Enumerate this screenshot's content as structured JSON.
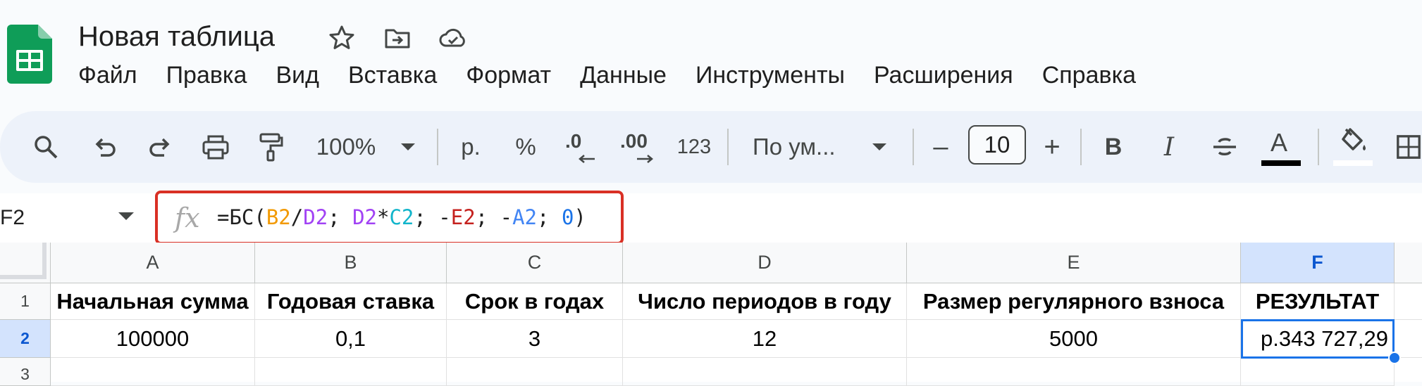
{
  "doc": {
    "title": "Новая таблица"
  },
  "menu": [
    "Файл",
    "Правка",
    "Вид",
    "Вставка",
    "Формат",
    "Данные",
    "Инструменты",
    "Расширения",
    "Справка"
  ],
  "toolbar": {
    "zoom": "100%",
    "currency": "р.",
    "percent": "%",
    "dec_decrease": ".0",
    "dec_increase": ".00",
    "number_format": "123",
    "font": "По ум...",
    "font_size": "10",
    "minus": "–",
    "plus": "+",
    "bold": "B",
    "italic": "I",
    "text_color_glyph": "A"
  },
  "formula_bar": {
    "name_box": "F2",
    "fx": "fx",
    "tokens": [
      {
        "t": "=БС(",
        "c": ""
      },
      {
        "t": "B2",
        "c": "c-b2"
      },
      {
        "t": "/",
        "c": ""
      },
      {
        "t": "D2",
        "c": "c-d2"
      },
      {
        "t": "; ",
        "c": ""
      },
      {
        "t": "D2",
        "c": "c-d2"
      },
      {
        "t": "*",
        "c": ""
      },
      {
        "t": "C2",
        "c": "c-c2"
      },
      {
        "t": "; -",
        "c": ""
      },
      {
        "t": "E2",
        "c": "c-e2"
      },
      {
        "t": "; -",
        "c": ""
      },
      {
        "t": "A2",
        "c": "c-a2"
      },
      {
        "t": "; ",
        "c": ""
      },
      {
        "t": "0",
        "c": "c-num"
      },
      {
        "t": ")",
        "c": ""
      }
    ]
  },
  "sheet": {
    "columns": [
      "A",
      "B",
      "C",
      "D",
      "E",
      "F"
    ],
    "selected_column": "F",
    "rows": [
      "1",
      "2",
      "3"
    ],
    "selected_row": "2",
    "selected_cell": "F2",
    "header_row": [
      "Начальная сумма",
      "Годовая ставка",
      "Срок в годах",
      "Число периодов в году",
      "Размер регулярного взноса",
      "РЕЗУЛЬТАТ"
    ],
    "data_row": [
      "100000",
      "0,1",
      "3",
      "12",
      "5000",
      "р.343 727,29"
    ]
  },
  "colors": {
    "accent": "#1a73e8",
    "sheets_green": "#0f9d58",
    "highlight_border": "#d93025",
    "selection_bg": "#d3e3fd"
  }
}
